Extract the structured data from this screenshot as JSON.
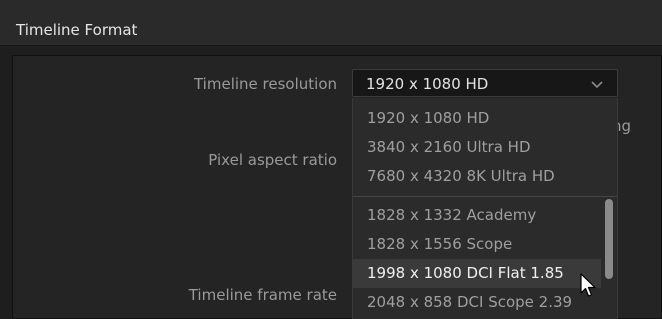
{
  "panel": {
    "title": "Timeline Format"
  },
  "labels": {
    "timeline_resolution": "Timeline resolution",
    "pixel_aspect_ratio": "Pixel aspect ratio",
    "timeline_frame_rate": "Timeline frame rate",
    "partial_right_text": "ng"
  },
  "dropdown": {
    "selected": "1920 x 1080 HD",
    "chevron_icon": "chevron-down-icon",
    "options_group1": [
      "1920 x 1080 HD",
      "3840 x 2160 Ultra HD",
      "7680 x 4320 8K Ultra HD"
    ],
    "options_group2": [
      "1828 x 1332 Academy",
      "1828 x 1556 Scope",
      "1998 x 1080 DCI Flat 1.85",
      "2048 x 858 DCI Scope 2.39"
    ],
    "hovered_option": "1998 x 1080 DCI Flat 1.85"
  },
  "colors": {
    "background": "#1e1e1e",
    "header": "#2a2a2a",
    "popup": "#2b2b2b",
    "hover": "#3a3a3a",
    "label_text": "#9a9a9a",
    "value_text": "#e3e3e3"
  }
}
